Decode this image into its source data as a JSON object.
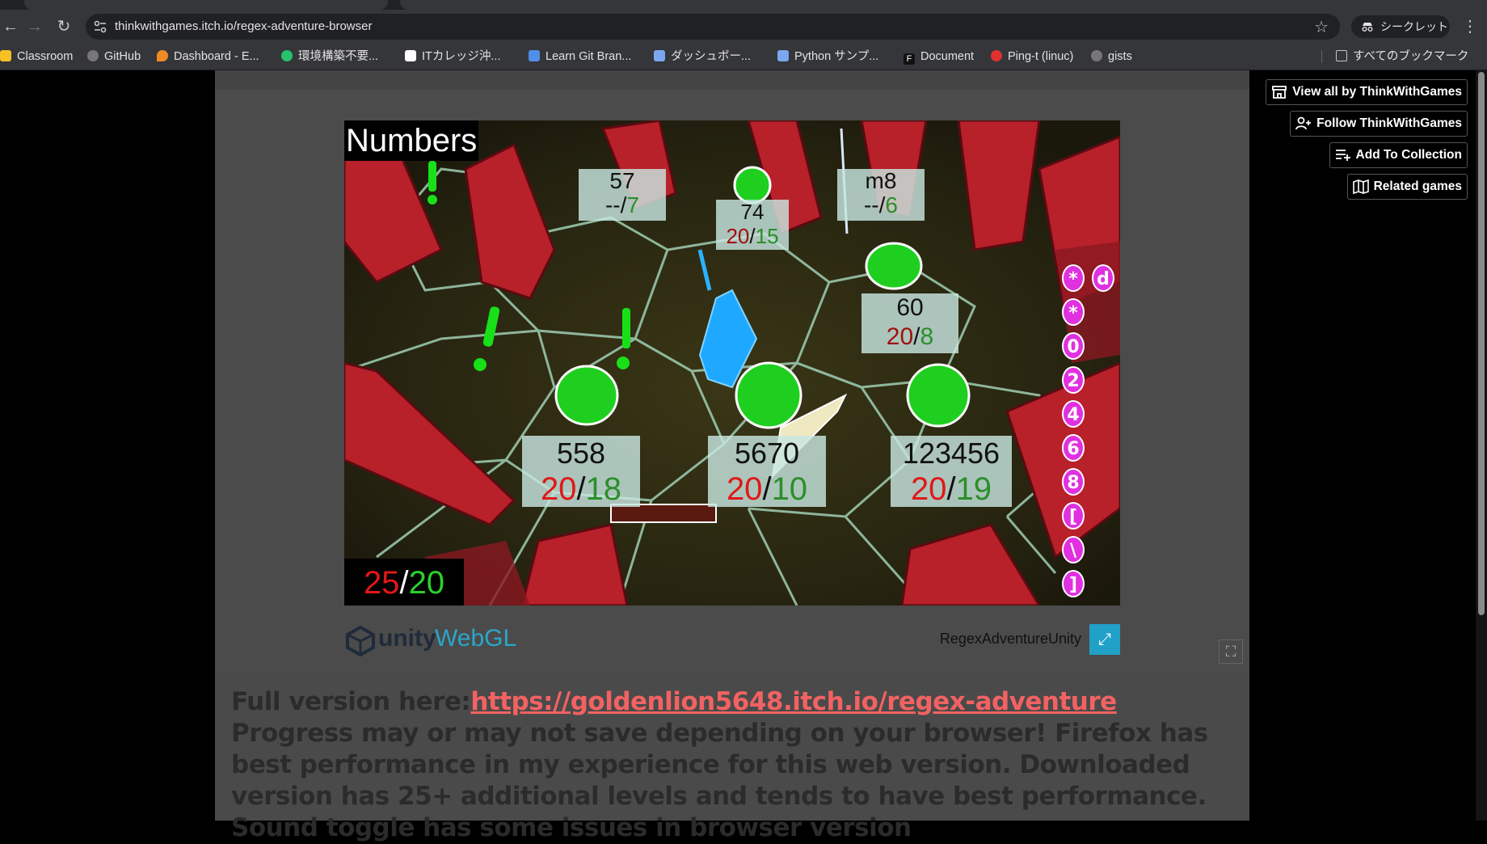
{
  "browser": {
    "url": "thinkwithgames.itch.io/regex-adventure-browser",
    "incognito_label": "シークレット",
    "bookmarks": [
      {
        "label": "Classroom",
        "color": "#f6c026"
      },
      {
        "label": "GitHub",
        "color": "#777777"
      },
      {
        "label": "Dashboard - E...",
        "color": "#f08a24"
      },
      {
        "label": "環境構築不要...",
        "color": "#27c26a"
      },
      {
        "label": "ITカレッジ沖...",
        "color": "#ffffff"
      },
      {
        "label": "Learn Git Bran...",
        "color": "#4f8fe8"
      },
      {
        "label": "ダッシュボー...",
        "color": "#7aa7f0"
      },
      {
        "label": "Python サンプ...",
        "color": "#7aa7f0"
      },
      {
        "label": "Document",
        "color": "#111111"
      },
      {
        "label": "Ping-t (linuc)",
        "color": "#e03030"
      },
      {
        "label": "gists",
        "color": "#777777"
      }
    ],
    "all_bookmarks_label": "すべてのブックマーク"
  },
  "sidebar_buttons": {
    "view_all": "View all by ThinkWithGames",
    "follow": "Follow ThinkWithGames",
    "add_collection": "Add To Collection",
    "related": "Related games"
  },
  "game": {
    "level_title": "Numbers",
    "score": {
      "current": "25",
      "sep": "/",
      "target": "20"
    },
    "enemies": [
      {
        "name": "57",
        "hp_left": "--",
        "sep": "/",
        "hp_right": "7"
      },
      {
        "name": "74",
        "hp_left": "20",
        "sep": "/",
        "hp_right": "15"
      },
      {
        "name": "m8",
        "hp_left": "--",
        "sep": "/",
        "hp_right": "6"
      },
      {
        "name": "60",
        "hp_left": "20",
        "sep": "/",
        "hp_right": "8"
      },
      {
        "name": "558",
        "hp_left": "20",
        "sep": "/",
        "hp_right": "18"
      },
      {
        "name": "5670",
        "hp_left": "20",
        "sep": "/",
        "hp_right": "10"
      },
      {
        "name": "123456",
        "hp_left": "20",
        "sep": "/",
        "hp_right": "19"
      }
    ],
    "tokens": [
      "*",
      "*",
      "0",
      "2",
      "4",
      "6",
      "8",
      "[",
      "\\",
      "]"
    ],
    "token_extra": "d",
    "engine": "unity",
    "platform": "WebGL",
    "product_name": "RegexAdventureUnity"
  },
  "description": {
    "prefix": "Full version here:",
    "link": "https://goldenlion5648.itch.io/regex-adventure",
    "body": " Progress may or may not save depending on your browser! Firefox has best performance in my experience for this web version. Downloaded version has 25+ additional levels and tends to have best performance. Sound toggle has some issues in browser version"
  }
}
